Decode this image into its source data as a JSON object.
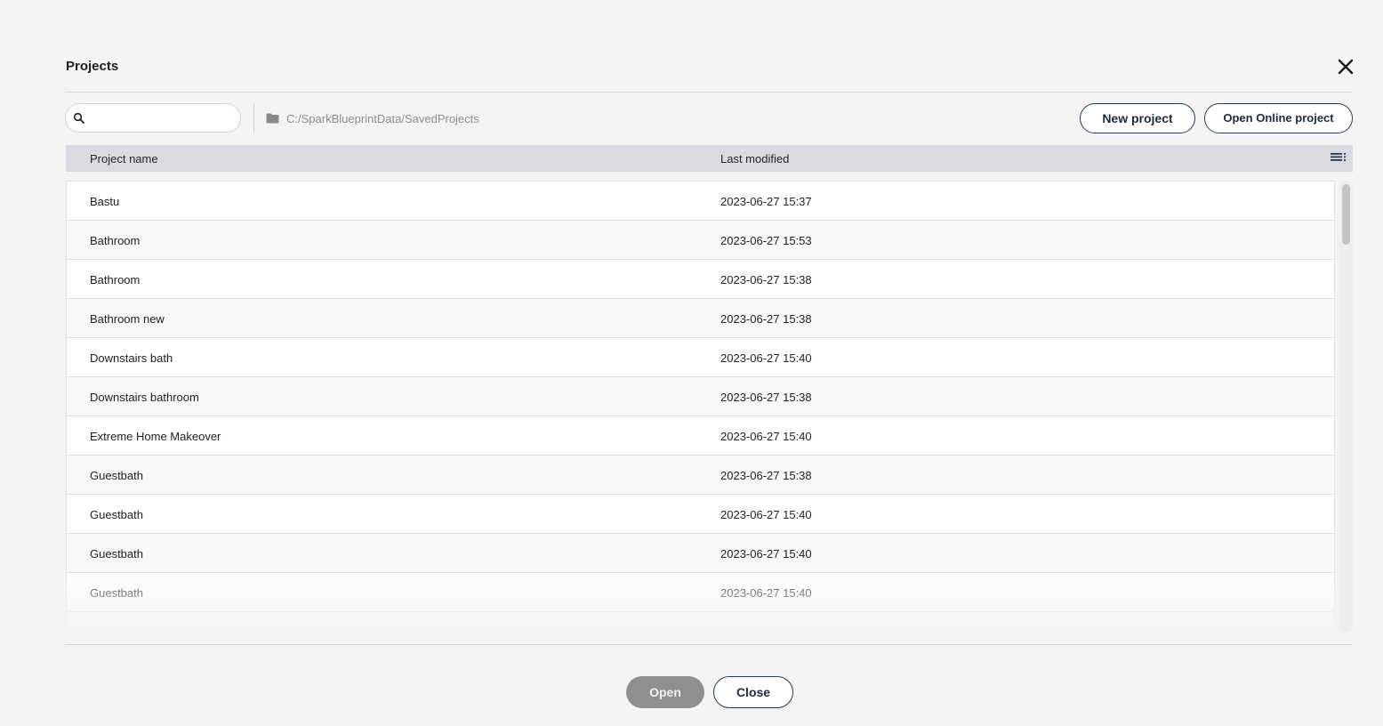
{
  "dialog": {
    "title": "Projects"
  },
  "toolbar": {
    "search": {
      "value": "",
      "placeholder": ""
    },
    "path": "C:/SparkBlueprintData/SavedProjects",
    "new_project_label": "New project",
    "open_online_label": "Open Online project"
  },
  "table": {
    "columns": {
      "name": "Project name",
      "modified": "Last modified"
    },
    "rows": [
      {
        "name": "Bastu",
        "modified": "2023-06-27 15:37"
      },
      {
        "name": "Bathroom",
        "modified": "2023-06-27 15:53"
      },
      {
        "name": "Bathroom",
        "modified": "2023-06-27 15:38"
      },
      {
        "name": "Bathroom new",
        "modified": "2023-06-27 15:38"
      },
      {
        "name": "Downstairs bath",
        "modified": "2023-06-27 15:40"
      },
      {
        "name": "Downstairs bathroom",
        "modified": "2023-06-27 15:38"
      },
      {
        "name": "Extreme Home Makeover",
        "modified": "2023-06-27 15:40"
      },
      {
        "name": "Guestbath",
        "modified": "2023-06-27 15:38"
      },
      {
        "name": "Guestbath",
        "modified": "2023-06-27 15:40"
      },
      {
        "name": "Guestbath",
        "modified": "2023-06-27 15:40"
      },
      {
        "name": "Guestbath",
        "modified": "2023-06-27 15:40"
      }
    ]
  },
  "footer": {
    "open_label": "Open",
    "close_label": "Close"
  },
  "icons": {
    "close": "close-icon",
    "search": "search-icon",
    "folder": "folder-icon",
    "view_toggle": "list-view-icon"
  },
  "colors": {
    "accent_border": "#2b3a55",
    "header_bg": "#d9dbe0",
    "disabled_button": "#8f8f8f"
  }
}
